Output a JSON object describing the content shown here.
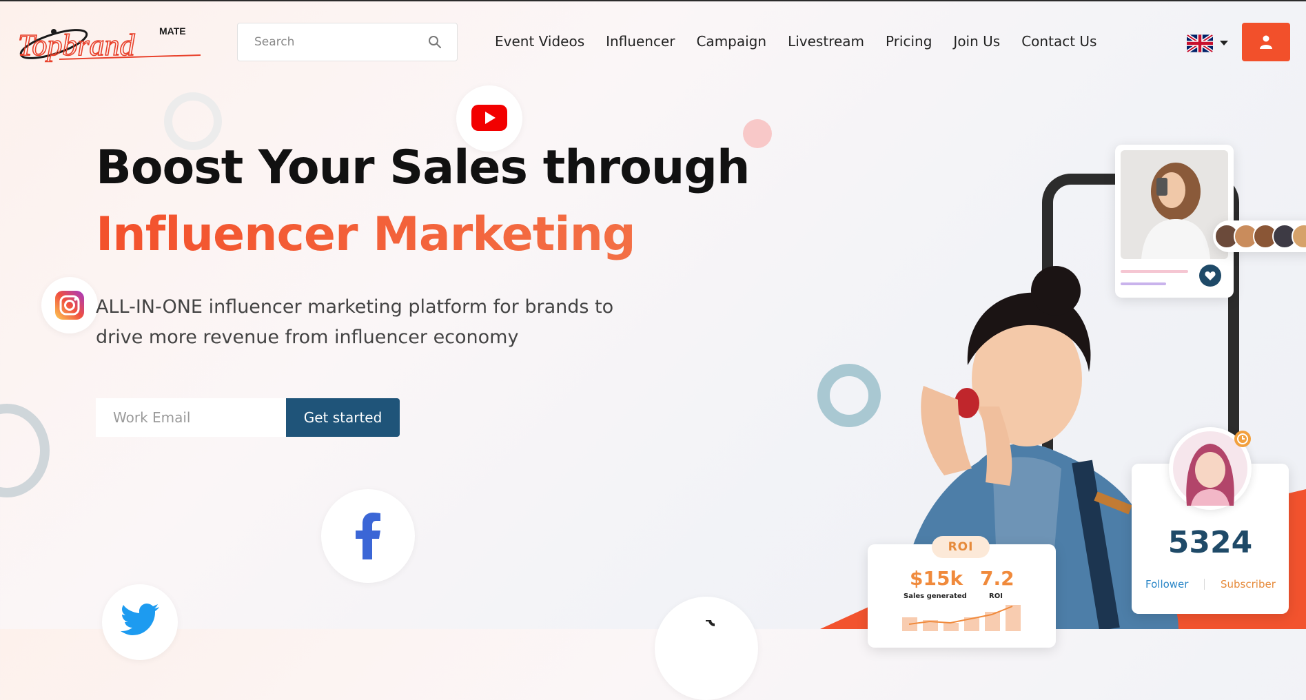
{
  "header": {
    "logo_text": "Topbrand",
    "logo_super": "MATE",
    "search_placeholder": "Search",
    "nav": [
      "Event Videos",
      "Influencer",
      "Campaign",
      "Livestream",
      "Pricing",
      "Join Us",
      "Contact Us"
    ],
    "language_flag": "uk-flag-icon"
  },
  "hero": {
    "title_line1": "Boost Your Sales through",
    "title_line2": "Influencer Marketing",
    "lead": "ALL-IN-ONE influencer marketing platform for brands to drive more revenue from influencer economy",
    "email_placeholder": "Work Email",
    "cta_label": "Get started"
  },
  "stats": {
    "roi_badge": "ROI",
    "sales_value": "$15k",
    "sales_label": "Sales generated",
    "roi_value": "7.2",
    "roi_label": "ROI",
    "count": "5324",
    "follower_label": "Follower",
    "subscriber_label": "Subscriber"
  },
  "colors": {
    "accent": "#f2502b",
    "cta": "#1f5479",
    "count": "#1f4a68"
  },
  "social_icons": [
    "youtube-icon",
    "instagram-icon",
    "facebook-icon",
    "twitter-icon",
    "tiktok-icon"
  ]
}
